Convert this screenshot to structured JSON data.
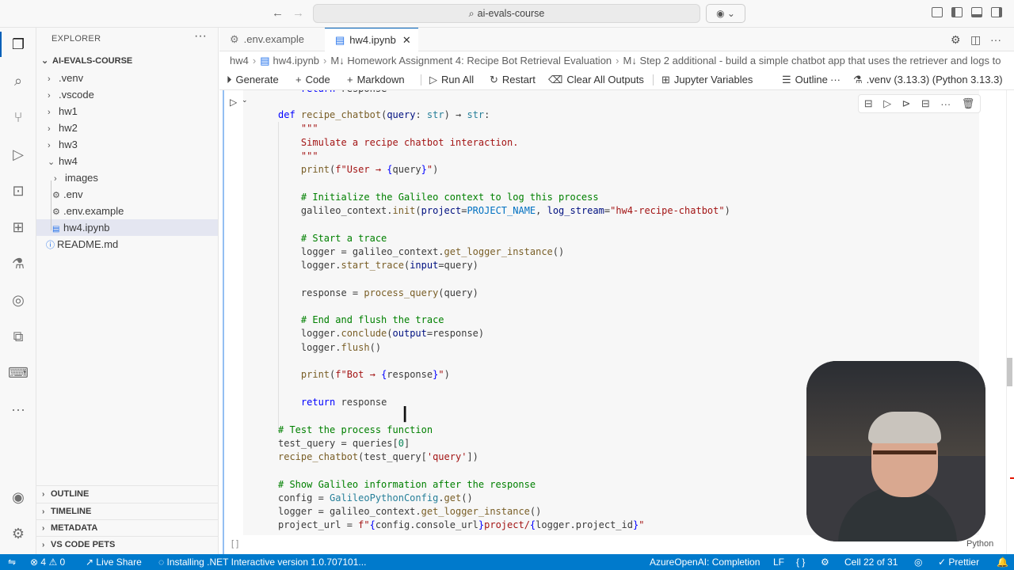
{
  "titlebar": {
    "search": "ai-evals-course",
    "back_icon": "arrow-left-icon",
    "forward_icon": "arrow-right-icon"
  },
  "sidebar": {
    "title": "EXPLORER",
    "root": "AI-EVALS-COURSE",
    "items": [
      {
        "label": ".venv",
        "type": "folder",
        "state": "collapsed"
      },
      {
        "label": ".vscode",
        "type": "folder",
        "state": "collapsed"
      },
      {
        "label": "hw1",
        "type": "folder",
        "state": "collapsed"
      },
      {
        "label": "hw2",
        "type": "folder",
        "state": "collapsed"
      },
      {
        "label": "hw3",
        "type": "folder",
        "state": "collapsed"
      },
      {
        "label": "hw4",
        "type": "folder",
        "state": "expanded"
      },
      {
        "label": "images",
        "type": "folder",
        "state": "collapsed"
      },
      {
        "label": ".env",
        "type": "settings-file"
      },
      {
        "label": ".env.example",
        "type": "settings-file"
      },
      {
        "label": "hw4.ipynb",
        "type": "notebook",
        "selected": true
      },
      {
        "label": "README.md",
        "type": "info-file"
      }
    ],
    "sections": [
      "OUTLINE",
      "TIMELINE",
      "METADATA",
      "VS CODE PETS"
    ]
  },
  "tabs": [
    {
      "label": ".env.example",
      "active": false
    },
    {
      "label": "hw4.ipynb",
      "active": true
    }
  ],
  "breadcrumbs": [
    "hw4",
    "hw4.ipynb",
    "M↓ Homework Assignment 4: Recipe Bot Retrieval Evaluation",
    "M↓ Step 2 additional - build a simple chatbot app that uses the retriever and logs to"
  ],
  "toolbar": {
    "generate": "Generate",
    "code": "Code",
    "markdown": "Markdown",
    "run_all": "Run All",
    "restart": "Restart",
    "clear_outputs": "Clear All Outputs",
    "variables": "Jupyter Variables",
    "outline": "Outline",
    "kernel": ".venv (3.13.3) (Python 3.13.3)"
  },
  "cell": {
    "language": "Python",
    "exec_count": "[ ]"
  },
  "statusbar": {
    "errors": "4",
    "warnings": "0",
    "live_share": "Live Share",
    "installing": "Installing .NET Interactive version 1.0.707101...",
    "completion": "AzureOpenAI: Completion",
    "eol": "LF",
    "braces": "{ }",
    "cell_pos": "Cell 22 of 31",
    "prettier": "Prettier"
  },
  "colors": {
    "accent": "#007acc",
    "selection": "#e4e6f1",
    "cell_bar": "#94bff2"
  }
}
